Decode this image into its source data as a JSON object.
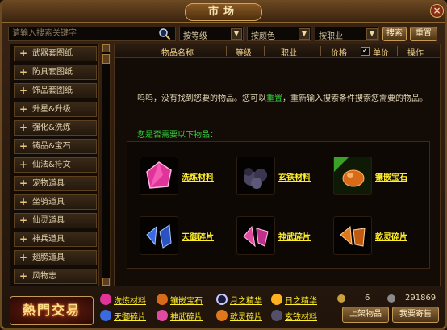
{
  "window": {
    "title": "市场",
    "close_label": "×"
  },
  "search": {
    "placeholder": "请输入搜索关键字",
    "level_dd": "按等级",
    "color_dd": "按颜色",
    "job_dd": "按职业",
    "dd_arrow": "▼",
    "search_btn": "搜索",
    "reset_btn": "重置"
  },
  "categories": [
    "武器套图纸",
    "防具套图纸",
    "饰品套图纸",
    "升星&升级",
    "强化&洗炼",
    "铸品&宝石",
    "仙法&符文",
    "宠物道具",
    "坐骑道具",
    "仙灵道具",
    "神兵道具",
    "翅膀道具",
    "风物志"
  ],
  "scroll": {
    "up": "▲",
    "down": "▼"
  },
  "columns": {
    "name": "物品名称",
    "level": "等级",
    "job": "职业",
    "price": "价格",
    "unit_price": "单价",
    "unit_checked": true,
    "action": "操作"
  },
  "message": {
    "prefix": "呜呜，没有找到您要的物品。您可以",
    "link": "重置",
    "suffix": "，重新输入搜索条件搜索您需要的物品。"
  },
  "need_title": "您是否需要以下物品：",
  "items": [
    {
      "name": "洗炼材料",
      "icon": "pink-crystal-icon",
      "color": "#e0349a"
    },
    {
      "name": "玄铁材料",
      "icon": "dark-ore-icon",
      "color": "#55506a"
    },
    {
      "name": "镶嵌宝石",
      "icon": "amber-gem-icon",
      "color": "#d96a1a"
    },
    {
      "name": "天御碎片",
      "icon": "blue-shard-icon",
      "color": "#3a6ae0"
    },
    {
      "name": "神武碎片",
      "icon": "pink-shard-icon",
      "color": "#e04aa0"
    },
    {
      "name": "乾灵碎片",
      "icon": "orange-shard-icon",
      "color": "#e0781a"
    }
  ],
  "logo": "熱門交易",
  "legend": [
    {
      "label": "洗炼材料",
      "icon": "pink-crystal-icon",
      "color": "#e0349a"
    },
    {
      "label": "镶嵌宝石",
      "icon": "amber-gem-icon",
      "color": "#d96a1a"
    },
    {
      "label": "月之精华",
      "icon": "moon-icon",
      "color": "#c8c8ff"
    },
    {
      "label": "日之精华",
      "icon": "sun-icon",
      "color": "#ffb020"
    },
    {
      "label": "天御碎片",
      "icon": "blue-shard-icon",
      "color": "#3a6ae0"
    },
    {
      "label": "神武碎片",
      "icon": "pink-shard-icon",
      "color": "#e04aa0"
    },
    {
      "label": "乾灵碎片",
      "icon": "orange-shard-icon",
      "color": "#e0781a"
    },
    {
      "label": "玄铁材料",
      "icon": "dark-ore-icon",
      "color": "#55506a"
    }
  ],
  "stats": {
    "count": "6",
    "money": "291869"
  },
  "buttons": {
    "shelf": "上架物品",
    "consign": "我要寄售"
  },
  "colors": {
    "gold_text": "#f2d28a",
    "link_green": "#33d23a",
    "item_yellow": "#ffef2b"
  }
}
